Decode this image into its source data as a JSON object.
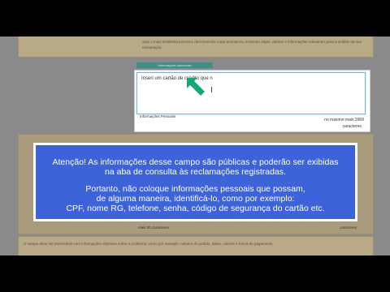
{
  "tab": {
    "label": "Informações adicionais"
  },
  "textarea": {
    "value": "Inseri um cartão de crédito que n"
  },
  "counter": {
    "line1": "no máximo mais 2968",
    "line2": "caracteres"
  },
  "labels": {
    "faded_field": "Informações Pessoais",
    "min_chars": "mais 30 caracteres",
    "chars_word": "caracteres"
  },
  "hints": {
    "top": "Seja o mais detalhista possível, descrevendo o que aconteceu, incluindo datas, valores e informações relevantes para a análise da sua reclamação.",
    "bottom": "O campo deve ser preenchido com informações objetivas sobre o problema, como por exemplo: número do pedido, datas, valores e forma de pagamento."
  },
  "alert": {
    "line1": "Atenção! As informações desse campo são públicas e poderão ser exibidas",
    "line2": "na aba de consulta às reclamações registradas.",
    "line3": "Portanto, não coloque informações pessoais que possam,",
    "line4": "de alguma maneira, identificá-lo, como por exemplo:",
    "line5": "CPF, nome RG, telefone, senha, código de segurança do cartão etc."
  },
  "colors": {
    "alert_bg": "#3d63d8",
    "alert_border": "#ffffff",
    "arrow": "#17a776",
    "tab": "#3f8f87"
  }
}
